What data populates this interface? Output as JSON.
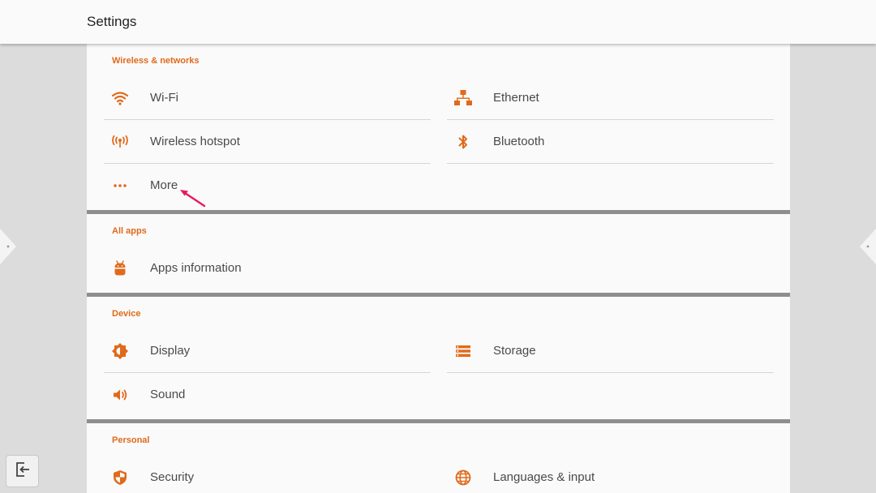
{
  "header": {
    "title": "Settings"
  },
  "accent_color": "#e06a1b",
  "sections": {
    "wireless": {
      "title": "Wireless & networks",
      "items": [
        {
          "label": "Wi-Fi",
          "icon": "wifi-icon"
        },
        {
          "label": "Ethernet",
          "icon": "ethernet-icon"
        },
        {
          "label": "Wireless hotspot",
          "icon": "hotspot-icon"
        },
        {
          "label": "Bluetooth",
          "icon": "bluetooth-icon"
        },
        {
          "label": "More",
          "icon": "more-dots-icon"
        }
      ]
    },
    "apps": {
      "title": "All apps",
      "items": [
        {
          "label": "Apps information",
          "icon": "android-icon"
        }
      ]
    },
    "device": {
      "title": "Device",
      "items": [
        {
          "label": "Display",
          "icon": "brightness-icon"
        },
        {
          "label": "Storage",
          "icon": "storage-icon"
        },
        {
          "label": "Sound",
          "icon": "volume-icon"
        }
      ]
    },
    "personal": {
      "title": "Personal",
      "items": [
        {
          "label": "Security",
          "icon": "shield-icon"
        },
        {
          "label": "Languages & input",
          "icon": "globe-icon"
        }
      ]
    }
  }
}
